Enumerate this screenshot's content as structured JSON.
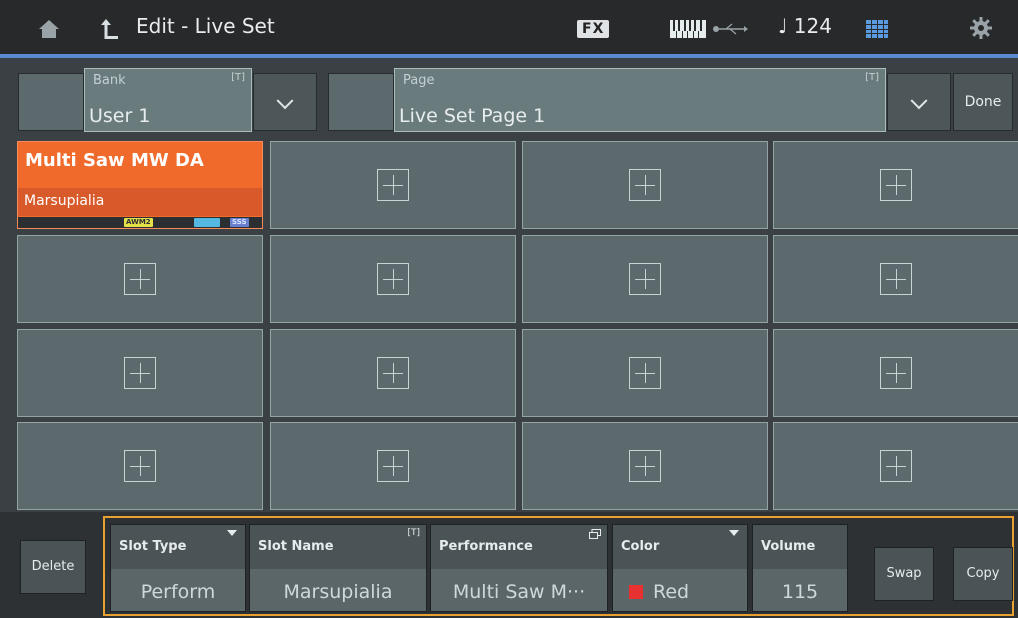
{
  "header": {
    "title": "Edit - Live Set",
    "fx_label": "FX",
    "tempo": "♩ 124"
  },
  "bank": {
    "label": "Bank",
    "value": "User 1",
    "text_marker": "[T]"
  },
  "page": {
    "label": "Page",
    "value": "Live Set Page 1",
    "text_marker": "[T]"
  },
  "done_label": "Done",
  "slots": [
    {
      "title": "Multi Saw MW DA",
      "name": "Marsupialia",
      "tags": [
        "AWM2",
        "SSS"
      ],
      "color": "#f06a2c"
    }
  ],
  "bottom": {
    "delete_label": "Delete",
    "swap_label": "Swap",
    "copy_label": "Copy",
    "slot_type": {
      "label": "Slot Type",
      "value": "Perform"
    },
    "slot_name": {
      "label": "Slot Name",
      "value": "Marsupialia",
      "text_marker": "[T]"
    },
    "performance": {
      "label": "Performance",
      "value": "Multi Saw M···"
    },
    "color": {
      "label": "Color",
      "value": "Red",
      "swatch": "#e83232"
    },
    "volume": {
      "label": "Volume",
      "value": "115"
    }
  },
  "colors": {
    "accent": "#5a8ad0",
    "highlight_frame": "#e8a030",
    "slot_bg": "#5d6a6d"
  }
}
